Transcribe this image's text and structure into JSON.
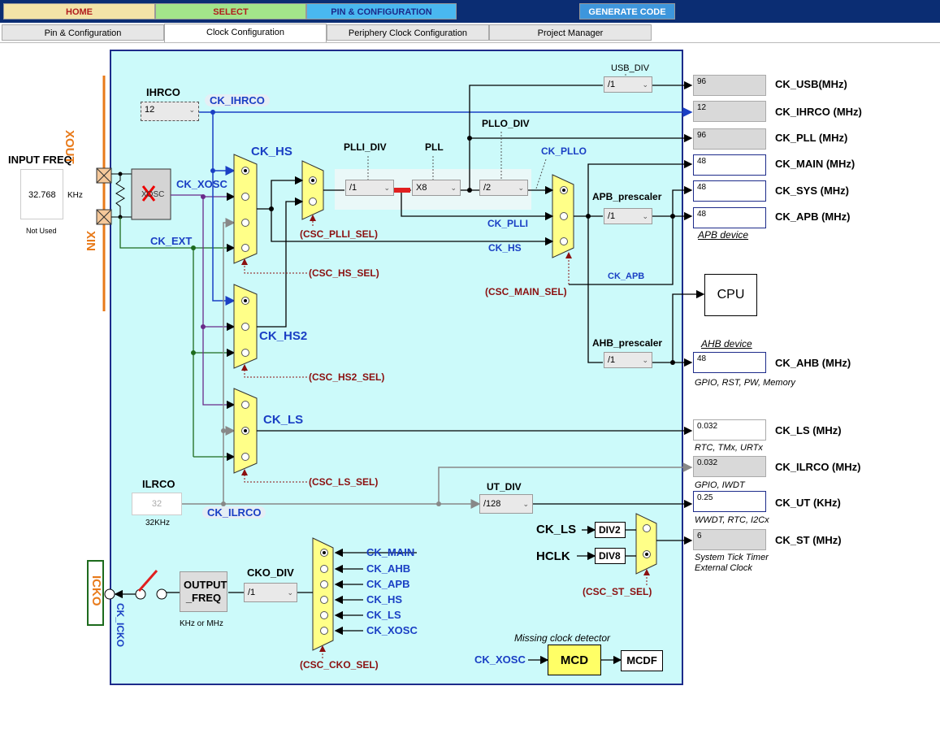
{
  "nav": {
    "home": "HOME",
    "select": "SELECT",
    "pin_config": "PIN & CONFIGURATION",
    "generate": "GENERATE CODE"
  },
  "tabs": [
    "Pin & Configuration",
    "Clock Configuration",
    "Periphery Clock Configuration",
    "Project Manager"
  ],
  "input": {
    "title": "INPUT FREQ",
    "value": "32.768",
    "unit": "KHz",
    "note": "Not Used",
    "xout": "XOUT",
    "xin": "XIN",
    "xosc_box": "XOSC",
    "ck_xosc": "CK_XOSC",
    "ck_ext": "CK_EXT"
  },
  "ihrco": {
    "title": "IHRCO",
    "value": "12",
    "signal": "CK_IHRCO"
  },
  "ilrco": {
    "title": "ILRCO",
    "value": "32",
    "freq": "32KHz",
    "signal": "CK_ILRCO"
  },
  "mux": {
    "ck_hs": "CK_HS",
    "ck_hs2": "CK_HS2",
    "ck_ls": "CK_LS",
    "hs_sel": "(CSC_HS_SEL)",
    "hs2_sel": "(CSC_HS2_SEL)",
    "ls_sel": "(CSC_LS_SEL)",
    "plli_sel": "(CSC_PLLI_SEL)",
    "main_sel": "(CSC_MAIN_SEL)",
    "st_sel": "(CSC_ST_SEL)",
    "cko_sel": "(CSC_CKO_SEL)"
  },
  "pll": {
    "plli_div_label": "PLLI_DIV",
    "plli_div": "/1",
    "pll_label": "PLL",
    "pll_mul": "X8",
    "pllo_div_label": "PLLO_DIV",
    "pllo_div": "/2",
    "ck_pllo": "CK_PLLO",
    "ck_plli": "CK_PLLI",
    "ck_hs_main": "CK_HS"
  },
  "usb_div": {
    "label": "USB_DIV",
    "value": "/1"
  },
  "apb": {
    "label": "APB_prescaler",
    "value": "/1",
    "ck_apb": "CK_APB",
    "device": "APB device"
  },
  "ahb": {
    "label": "AHB_prescaler",
    "value": "/1",
    "device": "AHB device"
  },
  "cpu": "CPU",
  "outputs": [
    {
      "value": "96",
      "label": "CK_USB(MHz)",
      "note": ""
    },
    {
      "value": "12",
      "label": "CK_IHRCO (MHz)",
      "note": ""
    },
    {
      "value": "96",
      "label": "CK_PLL (MHz)",
      "note": ""
    },
    {
      "value": "48",
      "label": "CK_MAIN (MHz)",
      "note": ""
    },
    {
      "value": "48",
      "label": "CK_SYS (MHz)",
      "note": ""
    },
    {
      "value": "48",
      "label": "CK_APB (MHz)",
      "note": ""
    },
    {
      "value": "48",
      "label": "CK_AHB (MHz)",
      "note": "GPIO, RST, PW, Memory"
    },
    {
      "value": "0.032",
      "label": "CK_LS (MHz)",
      "note": "RTC, TMx, URTx"
    },
    {
      "value": "0.032",
      "label": "CK_ILRCO (MHz)",
      "note": "GPIO, IWDT"
    },
    {
      "value": "0.25",
      "label": "CK_UT (KHz)",
      "note": "WWDT, RTC, I2Cx"
    },
    {
      "value": "6",
      "label": "CK_ST (MHz)",
      "note": "System Tick Timer"
    }
  ],
  "st_note2": "External Clock",
  "ut_div": {
    "label": "UT_DIV",
    "value": "/128"
  },
  "st": {
    "ck_ls": "CK_LS",
    "hclk": "HCLK",
    "div2": "DIV2",
    "div8": "DIV8"
  },
  "cko": {
    "icko": "ICKO",
    "ck_icko": "CK_ICKO",
    "output_freq": "OUTPUT_FREQ",
    "output_freq_l1": "OUTPUT",
    "output_freq_l2": "_FREQ",
    "unit": "KHz or MHz",
    "div_label": "CKO_DIV",
    "div_value": "/1",
    "inputs": [
      "CK_MAIN",
      "CK_AHB",
      "CK_APB",
      "CK_HS",
      "CK_LS",
      "CK_XOSC"
    ]
  },
  "mcd": {
    "title": "Missing clock detector",
    "input": "CK_XOSC",
    "box": "MCD",
    "out": "MCDF"
  },
  "colors": {
    "panel": "#ccfafa",
    "mux": "#ffff88",
    "signal_blue": "#1a3fc4",
    "sel_red": "#8b1010",
    "icko_orange": "#e87a1a"
  }
}
